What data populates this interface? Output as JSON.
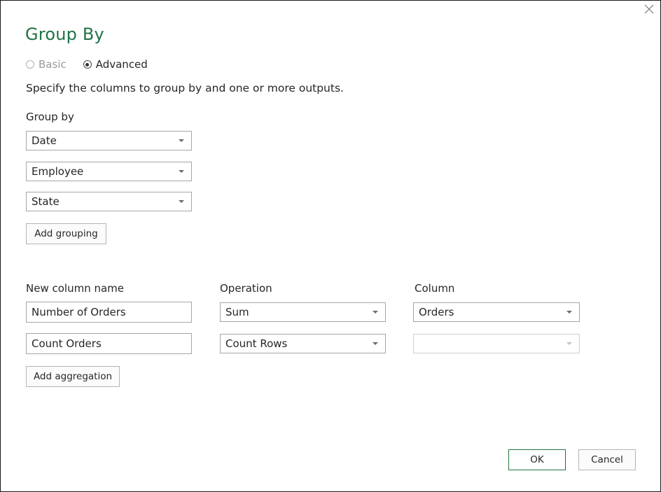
{
  "dialog": {
    "title": "Group By",
    "mode": {
      "basic_label": "Basic",
      "advanced_label": "Advanced",
      "selected": "Advanced"
    },
    "description": "Specify the columns to group by and one or more outputs."
  },
  "group_by": {
    "label": "Group by",
    "selects": [
      "Date",
      "Employee",
      "State"
    ],
    "add_button": "Add grouping"
  },
  "aggregations": {
    "headers": {
      "new_column_name": "New column name",
      "operation": "Operation",
      "column": "Column"
    },
    "rows": [
      {
        "name": "Number of Orders",
        "operation": "Sum",
        "column": "Orders"
      },
      {
        "name": "Count Orders",
        "operation": "Count Rows",
        "column": ""
      }
    ],
    "add_button": "Add aggregation"
  },
  "footer": {
    "ok_label": "OK",
    "cancel_label": "Cancel"
  },
  "icons": {
    "close": "close-icon",
    "dropdown": "chevron-down-icon"
  },
  "colors": {
    "title": "#217346",
    "ok_border": "#217346"
  }
}
